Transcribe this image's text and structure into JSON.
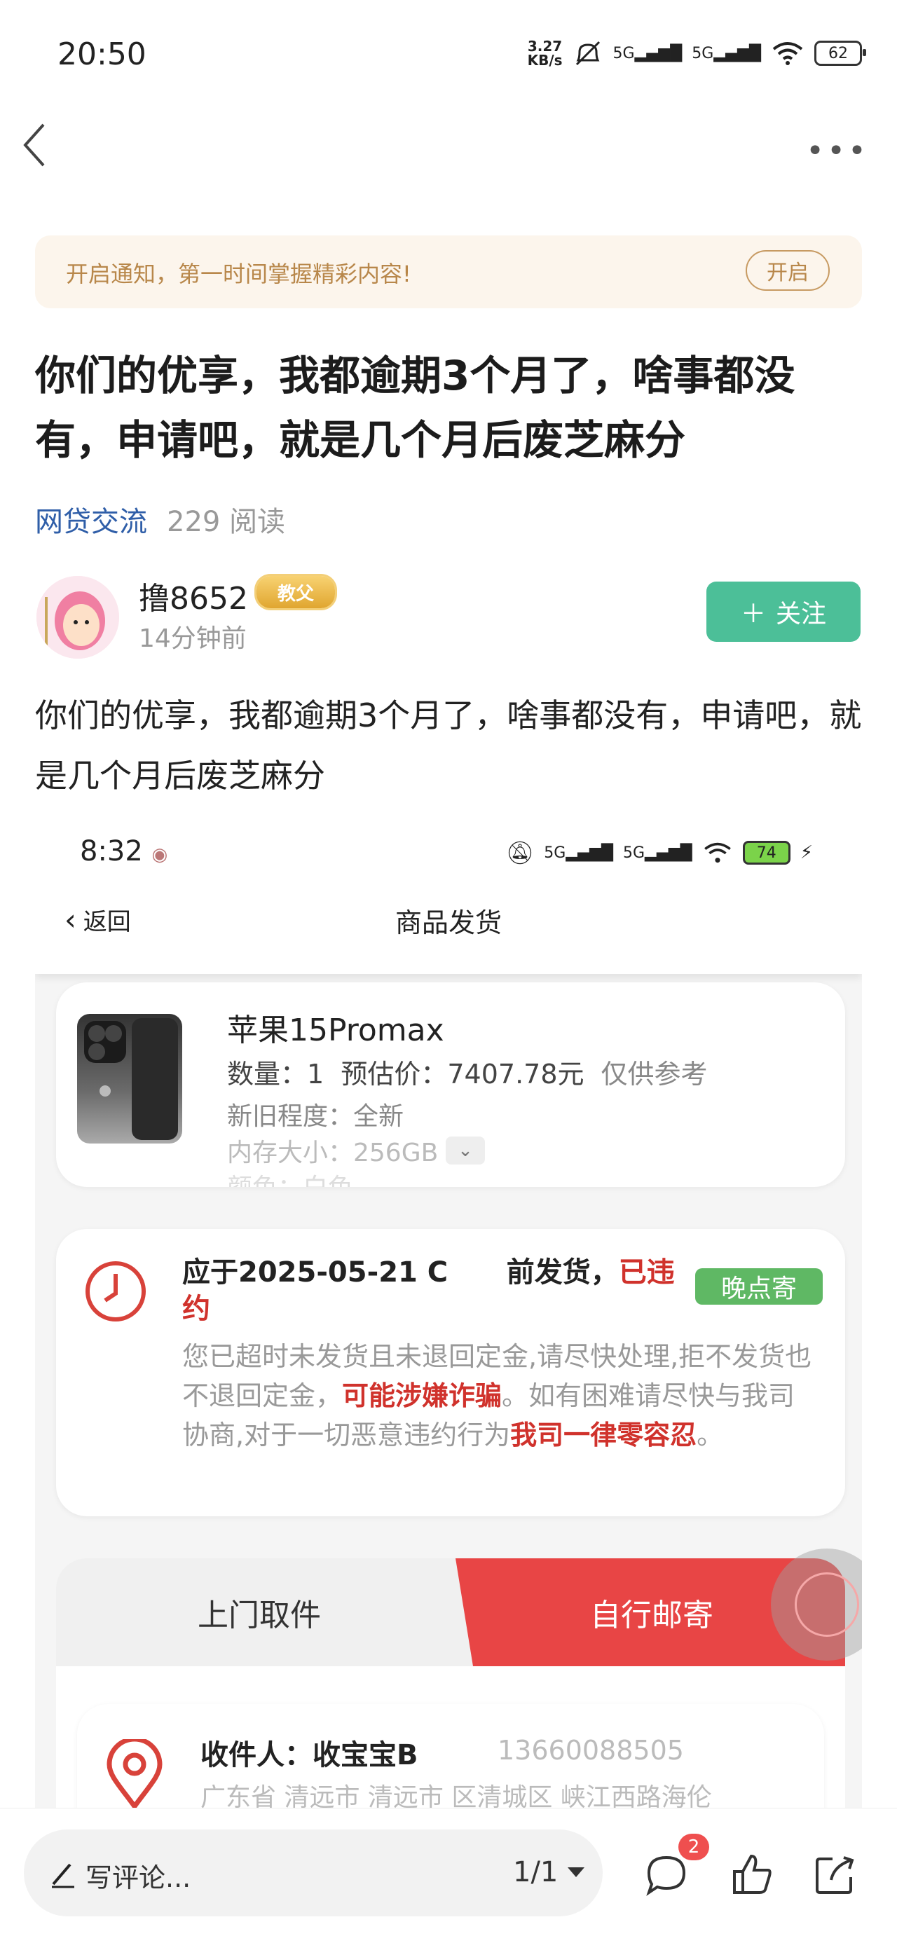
{
  "status_bar": {
    "time": "20:50",
    "speed": "3.27",
    "speed_unit": "KB/s",
    "net1": "5G",
    "net2": "5G",
    "battery": "62"
  },
  "notify_banner": {
    "text": "开启通知，第一时间掌握精彩内容!",
    "button": "开启"
  },
  "post": {
    "title": "你们的优享，我都逾期3个月了，啥事都没有，申请吧，就是几个月后废芝麻分",
    "tag": "网贷交流",
    "reads": "229 阅读",
    "author": "撸8652",
    "author_badge": "教父",
    "time": "14分钟前",
    "follow": "关注",
    "body": "你们的优享，我都逾期3个月了，啥事都没有，申请吧，就是几个月后废芝麻分"
  },
  "embedded": {
    "time": "8:32",
    "net1": "5G",
    "net2": "5G",
    "battery": "74",
    "back": "返回",
    "title": "商品发货",
    "product": {
      "name": "苹果15Promax",
      "qty_label": "数量：1",
      "price_label": "预估价：7407.78元",
      "ref": "仅供参考",
      "condition": "新旧程度：全新",
      "memory": "内存大小：256GB",
      "color": "颜色：白色"
    },
    "deadline": {
      "prefix": "应于2025-05-21 C",
      "mid": "前发货，",
      "red": "已违约",
      "late_button": "晚点寄"
    },
    "warning": {
      "p1": "您已超时未发货且未退回定金,请尽快处理,拒不发货也不退回定金，",
      "r1": "可能涉嫌诈骗",
      "p2": "。如有困难请尽快与我司协商,对于一切恶意违约行为",
      "r2": "我司一律零容忍",
      "p3": "。"
    },
    "tab_pickup": "上门取件",
    "tab_mail": "自行邮寄",
    "receiver": {
      "label": "收件人：收宝宝B",
      "phone": "13660088505",
      "address": "广东省 清远市 清远市 区清城区 峡江西路海伦"
    }
  },
  "bottom_bar": {
    "comment_placeholder": "写评论...",
    "pager": "1/1",
    "comment_count": "2"
  },
  "colors": {
    "follow": "#4cbf98",
    "tag": "#2f5ea8",
    "accent_red": "#e84545",
    "late_green": "#5fb864"
  }
}
